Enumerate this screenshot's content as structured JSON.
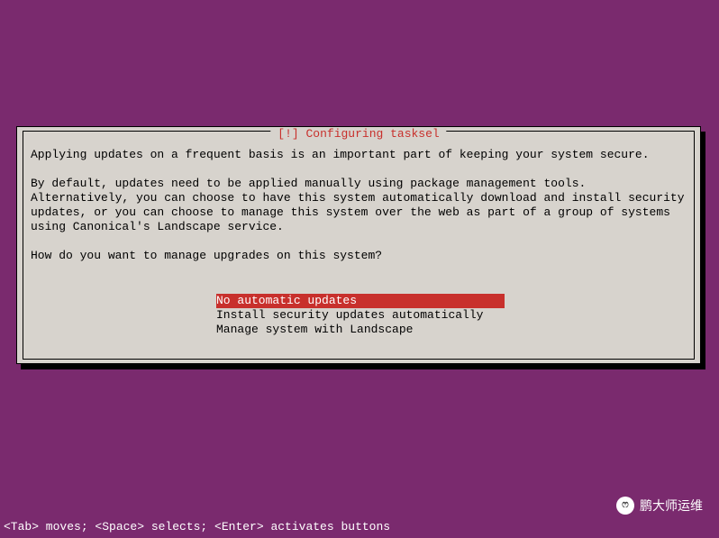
{
  "dialog": {
    "title": "[!] Configuring tasksel",
    "intro": "Applying updates on a frequent basis is an important part of keeping your system secure.",
    "body": "By default, updates need to be applied manually using package management tools. Alternatively, you can choose to have this system automatically download and install security updates, or you can choose to manage this system over the web as part of a group of systems using Canonical's Landscape service.",
    "question": "How do you want to manage upgrades on this system?",
    "options": [
      "No automatic updates",
      "Install security updates automatically",
      "Manage system with Landscape"
    ]
  },
  "help_bar": "<Tab> moves; <Space> selects; <Enter> activates buttons",
  "watermark": "鹏大师运维"
}
